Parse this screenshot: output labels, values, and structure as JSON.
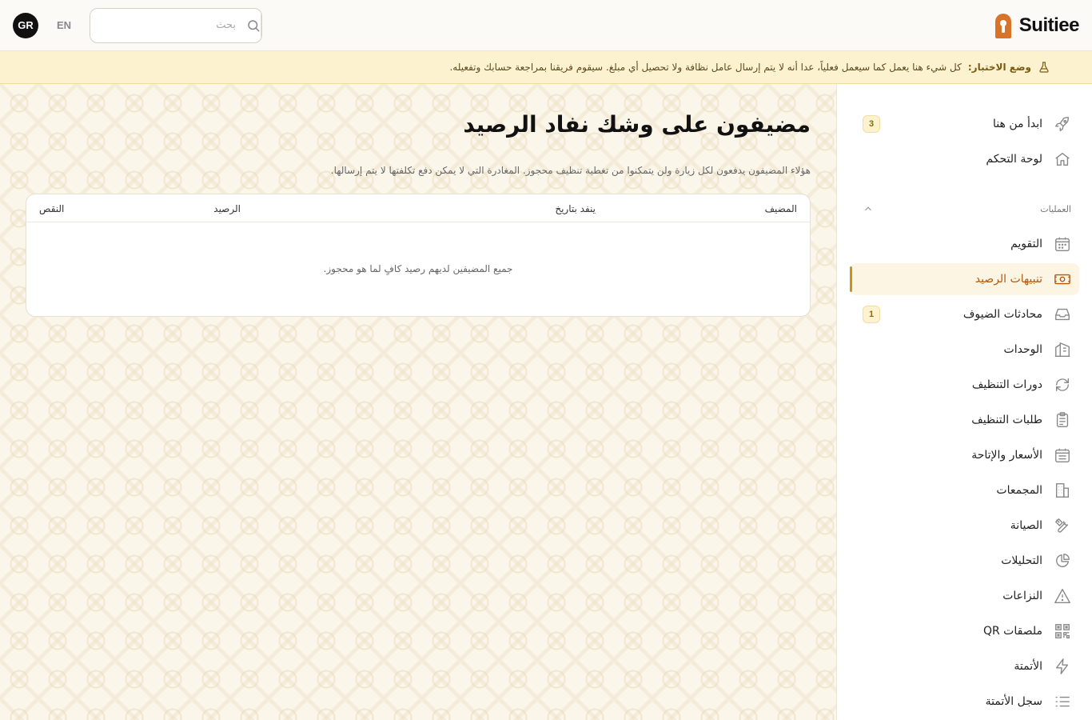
{
  "header": {
    "avatar_initials": "GR",
    "language": "EN",
    "search_placeholder": "بحث",
    "logo_text": "Suitiee",
    "brand_color": "#d8742a"
  },
  "banner": {
    "icon": "flask-icon",
    "title": "وضع الاختبار:",
    "message": "كل شيء هنا يعمل كما سيعمل فعلياً، عدا أنه لا يتم إرسال عامل نظافة ولا تحصيل أي مبلغ. سيقوم فريقنا بمراجعة حسابك وتفعيله."
  },
  "sidebar": {
    "top_items": [
      {
        "label": "ابدأ من هنا",
        "icon": "rocket-icon",
        "badge": "3"
      },
      {
        "label": "لوحة التحكم",
        "icon": "home-icon",
        "badge": ""
      }
    ],
    "section_label": "العمليات",
    "section_items": [
      {
        "label": "التقويم",
        "icon": "calendar-icon",
        "badge": ""
      },
      {
        "label": "تنبيهات الرصيد",
        "icon": "money-icon",
        "badge": "",
        "active": true
      },
      {
        "label": "محادثات الضيوف",
        "icon": "inbox-icon",
        "badge": "1"
      },
      {
        "label": "الوحدات",
        "icon": "building-icon",
        "badge": ""
      },
      {
        "label": "دورات التنظيف",
        "icon": "refresh-icon",
        "badge": ""
      },
      {
        "label": "طلبات التنظيف",
        "icon": "clipboard-icon",
        "badge": ""
      },
      {
        "label": "الأسعار والإتاحة",
        "icon": "calendar-grid-icon",
        "badge": ""
      },
      {
        "label": "المجمعات",
        "icon": "office-icon",
        "badge": ""
      },
      {
        "label": "الصيانة",
        "icon": "tools-icon",
        "badge": ""
      },
      {
        "label": "التحليلات",
        "icon": "pie-chart-icon",
        "badge": ""
      },
      {
        "label": "النزاعات",
        "icon": "warning-icon",
        "badge": ""
      },
      {
        "label": "ملصقات QR",
        "icon": "qr-icon",
        "badge": ""
      },
      {
        "label": "الأتمتة",
        "icon": "bolt-icon",
        "badge": ""
      },
      {
        "label": "سجل الأتمتة",
        "icon": "list-icon",
        "badge": ""
      }
    ]
  },
  "main": {
    "title": "مضيفون على وشك نفاد الرصيد",
    "description": "هؤلاء المضيفون يدفعون لكل زيارة ولن يتمكنوا من تغطية تنظيف محجوز. المغادرة التي لا يمكن دفع تكلفتها لا يتم إرسالها.",
    "table": {
      "columns": [
        "المضيف",
        "ينفد بتاريخ",
        "الرصيد",
        "النقص"
      ],
      "empty_message": "جميع المضيفين لديهم رصيد كافٍ لما هو محجوز."
    }
  }
}
